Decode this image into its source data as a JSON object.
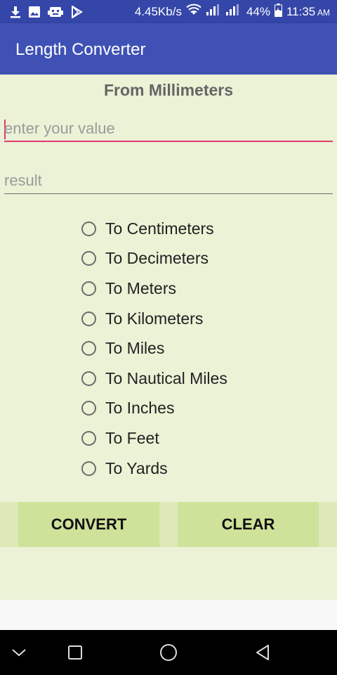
{
  "status_bar": {
    "net_speed": "4.45Kb/s",
    "battery": "44%",
    "time": "11:35",
    "ampm": "AM",
    "icons": [
      "download-icon",
      "image-icon",
      "robot-icon",
      "play-store-icon",
      "wifi-icon",
      "signal-1-icon",
      "signal-2-icon",
      "battery-icon"
    ]
  },
  "app_bar": {
    "title": "Length Converter",
    "color": "#3f51b5"
  },
  "main": {
    "from_label": "From Millimeters",
    "value_input": {
      "placeholder": "enter your value",
      "value": ""
    },
    "result_input": {
      "placeholder": "result",
      "value": ""
    },
    "options": [
      {
        "label": "To Centimeters",
        "selected": false
      },
      {
        "label": "To Decimeters",
        "selected": false
      },
      {
        "label": "To Meters",
        "selected": false
      },
      {
        "label": "To Kilometers",
        "selected": false
      },
      {
        "label": "To Miles",
        "selected": false
      },
      {
        "label": "To Nautical Miles",
        "selected": false
      },
      {
        "label": "To Inches",
        "selected": false
      },
      {
        "label": "To Feet",
        "selected": false
      },
      {
        "label": "To Yards",
        "selected": false
      }
    ],
    "convert_label": "CONVERT",
    "clear_label": "CLEAR",
    "background": "#ebf2d6",
    "button_color": "#cfe29a"
  },
  "nav_bar": {
    "buttons": [
      "back-icon",
      "recents-icon",
      "home-icon",
      "back-triangle-icon"
    ]
  }
}
